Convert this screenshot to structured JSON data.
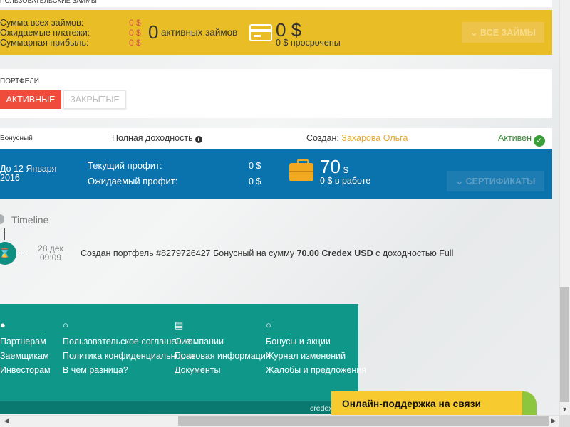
{
  "header": {
    "title": "ПОЛЬЗОВАТЕЛЬСКИЕ ЗАЙМЫ"
  },
  "summary": {
    "rows": [
      {
        "label": "Сумма всех займов:",
        "value": "0 $"
      },
      {
        "label": "Ожидаемые платежи:",
        "value": "0 $"
      },
      {
        "label": "Суммарная прибыль:",
        "value": "0 $"
      }
    ],
    "active_count": "0",
    "active_label": "активных займов",
    "card_amount": "0 $",
    "overdue_text": "0 $ просрочены",
    "all_loans_button": "ВСЕ ЗАЙМЫ",
    "all_loans_icon": "chevron-down-icon",
    "accent_color": "#e8bd26"
  },
  "portfolios": {
    "label": "ПОРТФЕЛИ",
    "tabs": [
      {
        "label": "АКТИВНЫЕ",
        "active": true
      },
      {
        "label": "ЗАКРЫТЫЕ",
        "active": false
      }
    ]
  },
  "portfolio": {
    "type": "Бонусный",
    "yield_label": "Полная доходность",
    "created_label": "Создан:",
    "author": "Захарова Ольга",
    "status": "Активен",
    "until": "До 12 Января 2016",
    "current_profit_label": "Текущий профит:",
    "current_profit_value": "0 $",
    "expected_profit_label": "Ожидаемый профит:",
    "expected_profit_value": "0 $",
    "amount": "70",
    "amount_currency": "$",
    "in_work": "0 $ в работе",
    "certificates_button": "СЕРТИФИКАТЫ",
    "blue_color": "#0a72ac"
  },
  "timeline": {
    "title": "Timeline",
    "events": [
      {
        "date": "28 дек",
        "time": "09:09",
        "text_prefix": "Создан портфель #8279726427 Бонусный на сумму",
        "amount": "70.00 Credex USD",
        "text_suffix": "с доходностью Full"
      }
    ]
  },
  "footer": {
    "columns": [
      {
        "icon": "user-icon",
        "links": [
          "Партнерам",
          "Заемщикам",
          "Инвесторам"
        ]
      },
      {
        "icon": "lightbulb-icon",
        "links": [
          "Пользовательское соглашение",
          "Политика конфиденциальности",
          "В чем разница?"
        ]
      },
      {
        "icon": "document-icon",
        "links": [
          "О компании",
          "Правовая информация",
          "Документы"
        ]
      },
      {
        "icon": "chat-icon",
        "links": [
          "Бонусы и акции",
          "Журнал изменений",
          "Жалобы и предложения"
        ]
      }
    ],
    "copyright": "credex"
  },
  "support": {
    "label": "Онлайн-поддержка на связи"
  }
}
